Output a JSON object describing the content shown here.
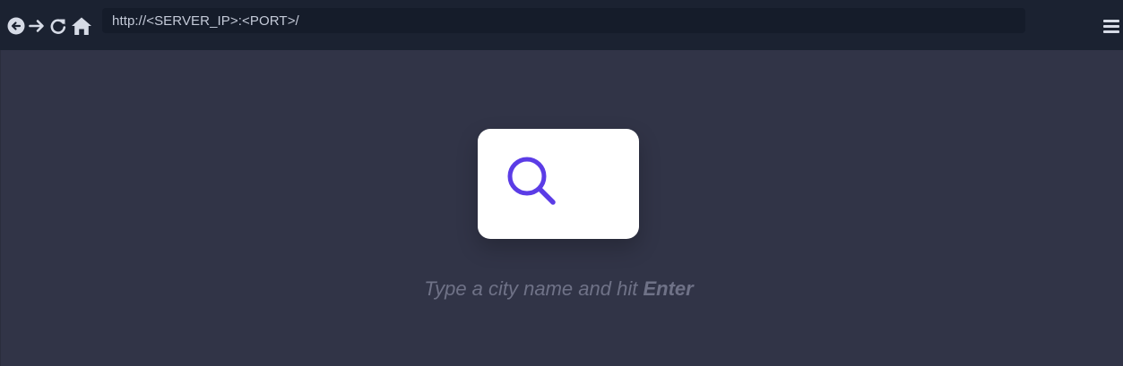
{
  "browser": {
    "url": "http://<SERVER_IP>:<PORT>/",
    "nav_icons": [
      "back-icon",
      "forward-icon",
      "reload-icon",
      "home-icon"
    ],
    "menu_icon": "hamburger-menu-icon"
  },
  "search": {
    "placeholder": "",
    "icon": "search-icon",
    "hint_text": "Type a city name and hit ",
    "hint_key": "Enter"
  },
  "colors": {
    "toolbar": "#1b2231",
    "address_bar": "#151c2a",
    "page_background": "#313447",
    "card": "#ffffff",
    "accent": "#5b3ce6",
    "hint_text": "#6f7287"
  }
}
